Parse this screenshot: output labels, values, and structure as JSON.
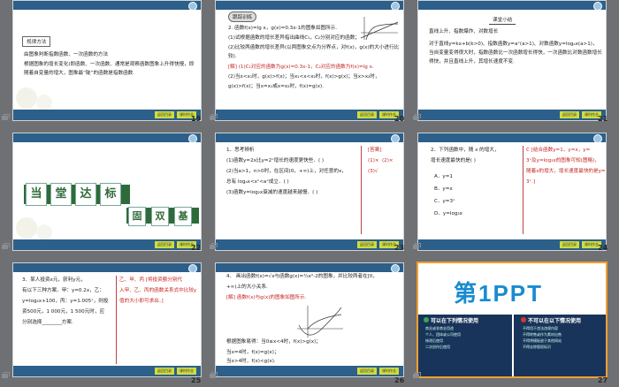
{
  "slides": [
    {
      "num": "19",
      "heading": "规律方法",
      "body": [
        "由图象判断指数函数、一次函数的方法",
        "根据图象的增长变化(即函数、一次函数、通常是观察函数图象上升得快慢，即随着自变量的增大，图象最“陡”的函数是指数函数."
      ]
    },
    {
      "num": "20",
      "heading": "跟踪训练",
      "body": [
        "2.  函数f(x)=lg x，g(x)=0.3x-1的图象如图所示.",
        "(1)试根据函数的增长差异指出曲线C₁，C₂分别对应的函数；",
        "(2)比较两函数的增长差异(以两图象交点为分界点，对f(x)，g(x)的大小进行比较).",
        "[解]  (1)C₁对应的函数为g(x)=0.3x-1，C₂对应的函数为f(x)=lg x.",
        "(2)当x<x₁时，g(x)>f(x)；当x₁<x<x₂时，f(x)>g(x)；当x>x₂时，",
        "g(x)>f(x)；当x=x₁或x=x₂时，f(x)=g(x)."
      ]
    },
    {
      "num": "21",
      "heading": "课堂小结",
      "body": [
        "直线上升、指数爆炸、对数增长",
        "对于直线y=kx+b(k>0)、指数函数y=aˣ(a>1)、对数函数y=logₐx(a>1)，当自变量变得很大时，指数函数比一次函数增长得快，一次函数比对数函数增长得快，并且直线上升，其增长速度不变."
      ]
    },
    {
      "num": "22",
      "title_chars": [
        "当",
        "堂",
        "达",
        "标"
      ],
      "subtitle_chars": [
        "固",
        "双",
        "基"
      ]
    },
    {
      "num": "23",
      "body": [
        "1．思考辨析",
        "(1)函数y=2x比y=2ˣ增长的速度更快些．(    )",
        "(2)当a>1，n>0时，在区间(0，+∞)上，对任意的x，",
        "总有 logₐx<xⁿ<aˣ成立．(    )",
        "(3)函数y=log₂x衰减的速度越来越慢．(    )"
      ],
      "answer_label": "[答案]",
      "answers": [
        "(1)×",
        "(2)×",
        "(3)√"
      ]
    },
    {
      "num": "24",
      "body": [
        "2．下列函数中，随 x 的增大，",
        "增长速度最快的是(    )",
        "A．y=1",
        "B．y=x",
        "C．y=3ˣ",
        "D．y=log₃x"
      ],
      "answer_text": [
        "C  [结合函数y=1，y=x，y=",
        "3ˣ及y=log₃x的图象可知(图略)，",
        "随着x的增大，增长速度最快的是y=",
        "3ˣ.]"
      ]
    },
    {
      "num": "25",
      "body": [
        "3．某人投资x元，获利y元，",
        "有以下三种方案．甲：y=0.2x，乙：",
        "y=log₂x+100，丙：y=1.005ˣ，则投",
        "资500元，1 000元，1 500元时，应",
        "分别选择________方案."
      ],
      "answer_text": [
        "乙、甲、丙  [将投资额分别代",
        "入甲、乙、丙的函数关系式中比较y",
        "值的大小即可求出．]"
      ]
    },
    {
      "num": "26",
      "body": [
        "4．  画出函数f(x)=√x与函数g(x)=¼x²-2的图象，并比较两者在[0，",
        "+∞)上的大小关系.",
        "[解]  函数f(x)与g(x)的图象如图所示.",
        "根据图象易得：当0≤x<4时，f(x)>g(x)；",
        "当x=4时，f(x)=g(x)；",
        "当x>4时，f(x)<g(x)."
      ]
    },
    {
      "num": "27",
      "logo": "第1PPT",
      "left_head": "可以在下列情况使用",
      "right_head": "不可以在以下情况使用",
      "left_items": [
        "商业或非商业用途",
        "个人、团体或公司使用",
        "修改后使用",
        "二次创作后使用"
      ],
      "right_items": [
        "不得用于违法违规内容",
        "不得转售或作为素材出售",
        "不得将模板放于其他网站",
        "不得去除版权标识"
      ]
    }
  ],
  "buttons": {
    "prev": "返回目录",
    "next": "课时作业"
  },
  "colors": {
    "primary": "#2c5f8a",
    "accent": "#c4241f",
    "lime": "#cfdc3e"
  }
}
